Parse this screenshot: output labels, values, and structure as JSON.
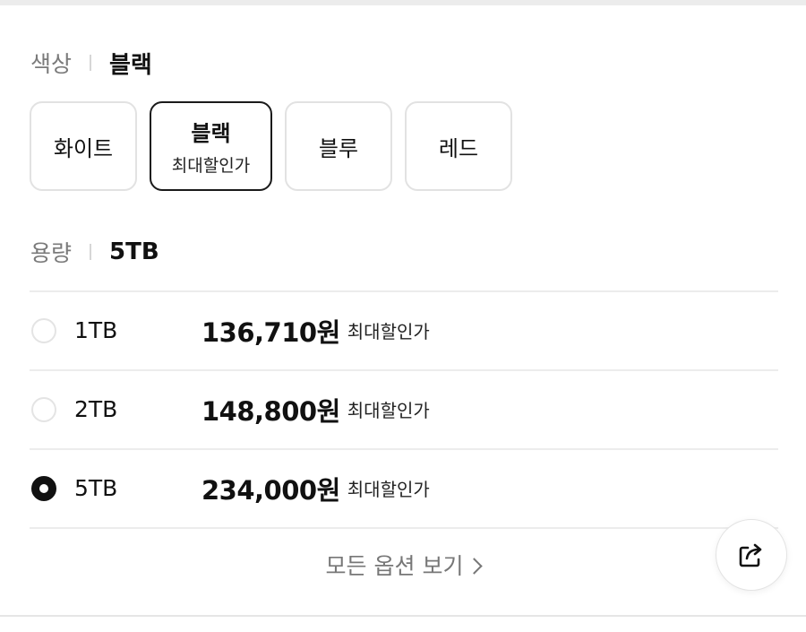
{
  "color_section": {
    "label": "색상",
    "selected_value": "블랙",
    "options": [
      {
        "label": "화이트",
        "sub": ""
      },
      {
        "label": "블랙",
        "sub": "최대할인가"
      },
      {
        "label": "블루",
        "sub": ""
      },
      {
        "label": "레드",
        "sub": ""
      }
    ],
    "selected_index": 1
  },
  "capacity_section": {
    "label": "용량",
    "selected_value": "5TB",
    "options": [
      {
        "size": "1TB",
        "price": "136,710원",
        "badge": "최대할인가",
        "checked": false
      },
      {
        "size": "2TB",
        "price": "148,800원",
        "badge": "최대할인가",
        "checked": false
      },
      {
        "size": "5TB",
        "price": "234,000원",
        "badge": "최대할인가",
        "checked": true
      }
    ]
  },
  "view_all_label": "모든 옵션 보기",
  "icons": {
    "share": "share-icon",
    "chevron": "chevron-right-icon"
  }
}
